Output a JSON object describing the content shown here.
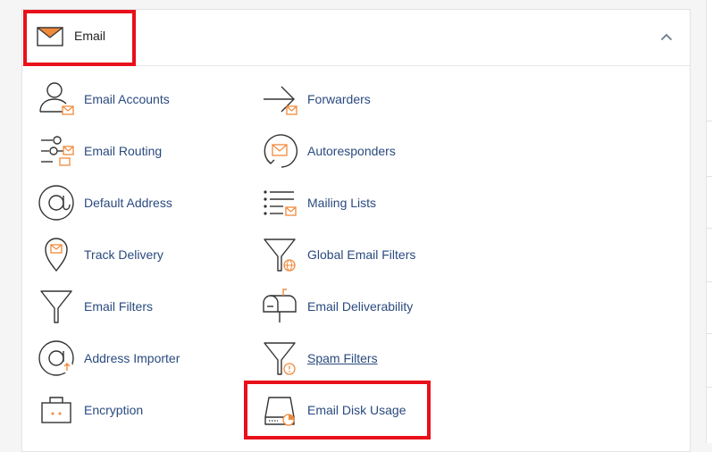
{
  "section": {
    "title": "Email",
    "icon": "envelope-icon",
    "collapse_icon": "chevron-up-icon"
  },
  "accent_color": "#f08a3c",
  "highlight_color": "#e8101a",
  "tools_left": [
    {
      "label": "Email Accounts",
      "icon": "email-accounts-icon"
    },
    {
      "label": "Email Routing",
      "icon": "email-routing-icon"
    },
    {
      "label": "Default Address",
      "icon": "at-sign-icon"
    },
    {
      "label": "Track Delivery",
      "icon": "map-pin-icon"
    },
    {
      "label": "Email Filters",
      "icon": "filter-icon"
    },
    {
      "label": "Address Importer",
      "icon": "address-importer-icon"
    },
    {
      "label": "Encryption",
      "icon": "encryption-icon"
    }
  ],
  "tools_right": [
    {
      "label": "Forwarders",
      "icon": "forward-arrow-icon"
    },
    {
      "label": "Autoresponders",
      "icon": "autoresponder-icon"
    },
    {
      "label": "Mailing Lists",
      "icon": "mailing-list-icon"
    },
    {
      "label": "Global Email Filters",
      "icon": "global-filter-icon"
    },
    {
      "label": "Email Deliverability",
      "icon": "mailbox-icon"
    },
    {
      "label": "Spam Filters",
      "icon": "spam-filter-icon"
    },
    {
      "label": "Email Disk Usage",
      "icon": "disk-usage-icon"
    }
  ]
}
